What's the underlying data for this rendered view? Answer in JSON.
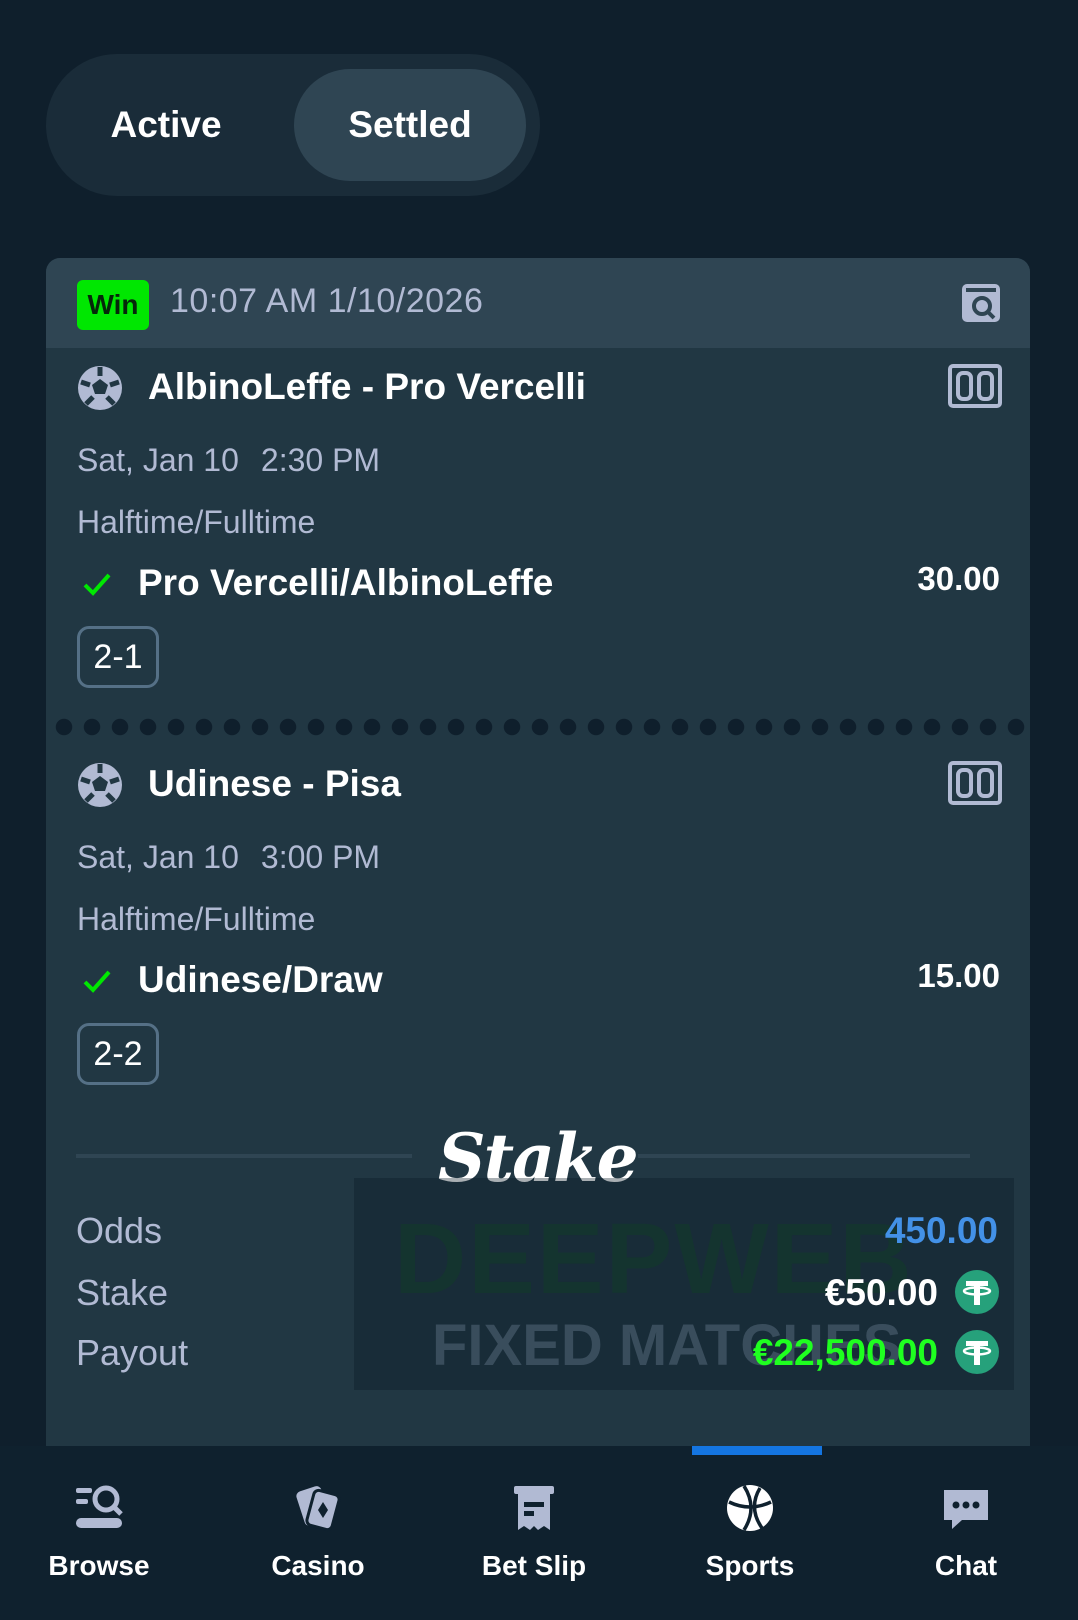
{
  "tabs": {
    "active_label": "Active",
    "settled_label": "Settled"
  },
  "bet": {
    "status_badge": "Win",
    "timestamp": "10:07 AM 1/10/2026",
    "legs": [
      {
        "teams": "AlbinoLeffe - Pro Vercelli",
        "date": "Sat, Jan 10",
        "time": "2:30 PM",
        "market": "Halftime/Fulltime",
        "selection": "Pro Vercelli/AlbinoLeffe",
        "odds": "30.00",
        "score": "2-1"
      },
      {
        "teams": "Udinese - Pisa",
        "date": "Sat, Jan 10",
        "time": "3:00 PM",
        "market": "Halftime/Fulltime",
        "selection": "Udinese/Draw",
        "odds": "15.00",
        "score": "2-2"
      }
    ],
    "logo_text": "Stake",
    "summary": {
      "odds_label": "Odds",
      "odds_value": "450.00",
      "stake_label": "Stake",
      "stake_value": "€50.00",
      "payout_label": "Payout",
      "payout_value": "€22,500.00"
    }
  },
  "watermark": {
    "line1": "DEEPWEB",
    "line2": "FIXED MATCHES"
  },
  "nav": [
    {
      "label": "Browse",
      "icon": "browse-icon"
    },
    {
      "label": "Casino",
      "icon": "cards-icon"
    },
    {
      "label": "Bet Slip",
      "icon": "betslip-icon"
    },
    {
      "label": "Sports",
      "icon": "basketball-icon",
      "selected": true
    },
    {
      "label": "Chat",
      "icon": "chat-icon"
    }
  ],
  "colors": {
    "background": "#0f1f2c",
    "card": "#213743",
    "card_header": "#2f4553",
    "win_green": "#00e701",
    "payout_green": "#1fff20",
    "odds_blue": "#4391e7",
    "muted_text": "#b1bad3",
    "nav_indicator": "#1475e1",
    "tether": "#26a17b"
  }
}
